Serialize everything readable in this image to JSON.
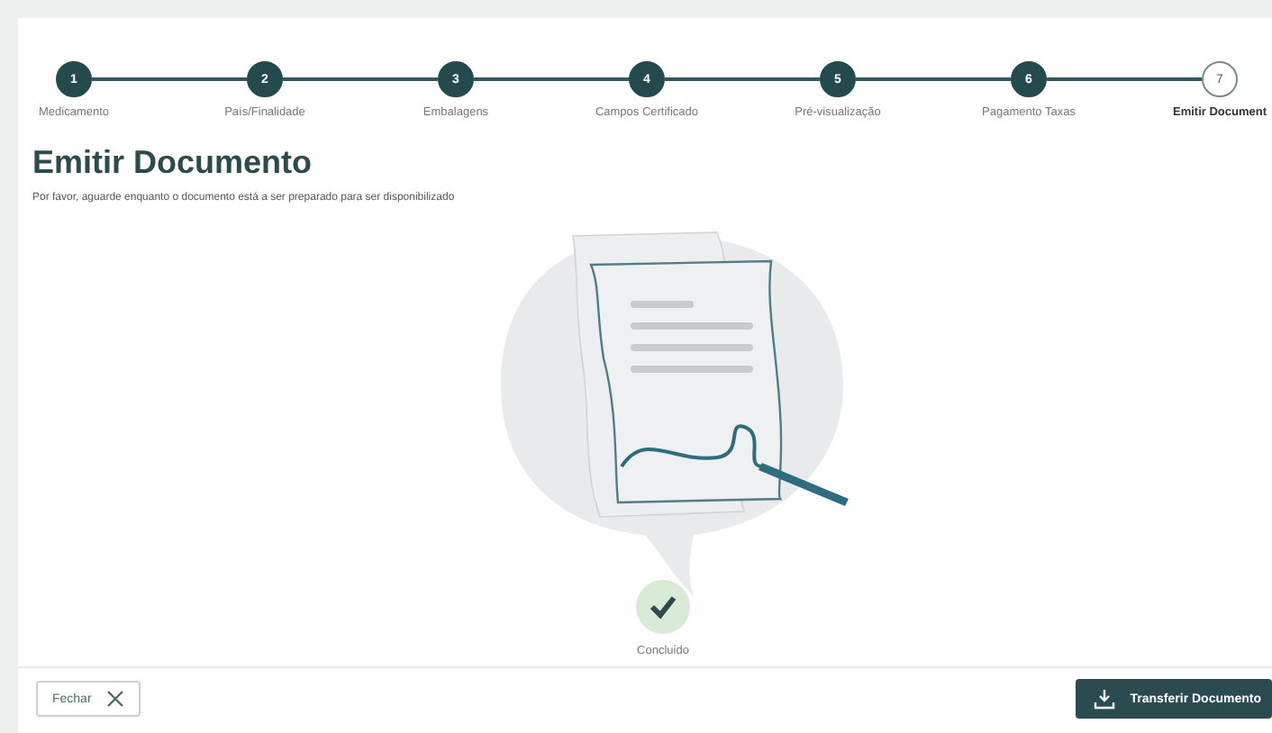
{
  "steps": [
    {
      "number": "1",
      "label": "Medicamento",
      "completed": true,
      "selected": false
    },
    {
      "number": "2",
      "label": "País/Finalidade",
      "completed": true,
      "selected": false
    },
    {
      "number": "3",
      "label": "Embalagens",
      "completed": true,
      "selected": false
    },
    {
      "number": "4",
      "label": "Campos Certificado",
      "completed": true,
      "selected": false
    },
    {
      "number": "5",
      "label": "Pré-visualização",
      "completed": true,
      "selected": false
    },
    {
      "number": "6",
      "label": "Pagamento Taxas",
      "completed": true,
      "selected": false
    },
    {
      "number": "7",
      "label": "Emitir Document",
      "completed": false,
      "selected": true
    }
  ],
  "title": "Emitir Documento",
  "subtitle": "Por favor, aguarde enquanto o documento está a ser preparado para ser disponibilizado",
  "status": {
    "label": "Concluido",
    "done": true
  },
  "footer": {
    "close_button": "Fechar",
    "download_button": "Transferir Documento"
  }
}
